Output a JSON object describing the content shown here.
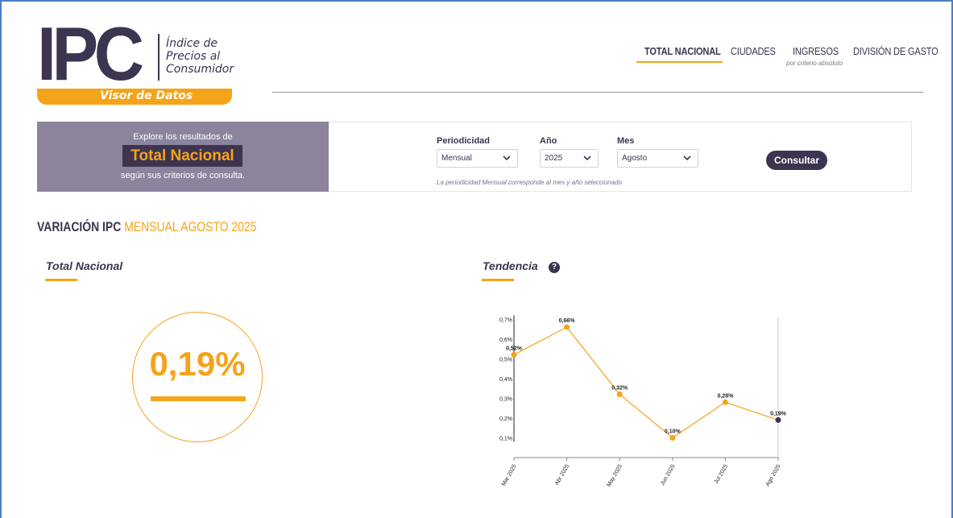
{
  "logo": {
    "acronym": "IPC",
    "line1": "Índice de",
    "line2": "Precios al",
    "line3": "Consumidor",
    "band": "Visor de Datos"
  },
  "nav": {
    "items": [
      {
        "label": "TOTAL NACIONAL",
        "active": true
      },
      {
        "label": "CIUDADES"
      },
      {
        "label": "INGRESOS",
        "sub": "por criterio absoluto"
      },
      {
        "label": "DIVISIÓN DE GASTO"
      }
    ]
  },
  "explore": {
    "top": "Explore los resultados de",
    "title": "Total Nacional",
    "bottom": "según sus criterios de consulta."
  },
  "query": {
    "periodicidad_label": "Periodicidad",
    "periodicidad_value": "Mensual",
    "anio_label": "Año",
    "anio_value": "2025",
    "mes_label": "Mes",
    "mes_value": "Agosto",
    "note": "La periodicidad Mensual corresponde al mes y año seleccionado",
    "button": "Consultar"
  },
  "section": {
    "title_strong": "VARIACIÓN IPC",
    "title_accent": "MENSUAL AGOSTO 2025"
  },
  "total": {
    "title": "Total Nacional",
    "value": "0,19%"
  },
  "trend": {
    "title": "Tendencia",
    "help": "?"
  },
  "colors": {
    "primary": "#3d3450",
    "accent": "#f5a31a",
    "panel": "#8c849d"
  },
  "chart_data": {
    "type": "line",
    "categories": [
      "Mar 2025",
      "Abr 2025",
      "May 2025",
      "Jun 2025",
      "Jul 2025",
      "Ago 2025"
    ],
    "values": [
      0.52,
      0.66,
      0.32,
      0.1,
      0.28,
      0.19
    ],
    "labels": [
      "0,52%",
      "0,66%",
      "0,32%",
      "0,10%",
      "0,28%",
      "0,19%"
    ],
    "y_ticks": [
      {
        "v": 0.1,
        "label": "0,1%"
      },
      {
        "v": 0.2,
        "label": "0,2%"
      },
      {
        "v": 0.3,
        "label": "0,3%"
      },
      {
        "v": 0.4,
        "label": "0,4%"
      },
      {
        "v": 0.5,
        "label": "0,5%"
      },
      {
        "v": 0.6,
        "label": "0,6%"
      },
      {
        "v": 0.7,
        "label": "0,7%"
      }
    ],
    "ylim": [
      0,
      0.75
    ],
    "line_color": "#f5a31a",
    "highlight_color": "#3d3450"
  }
}
